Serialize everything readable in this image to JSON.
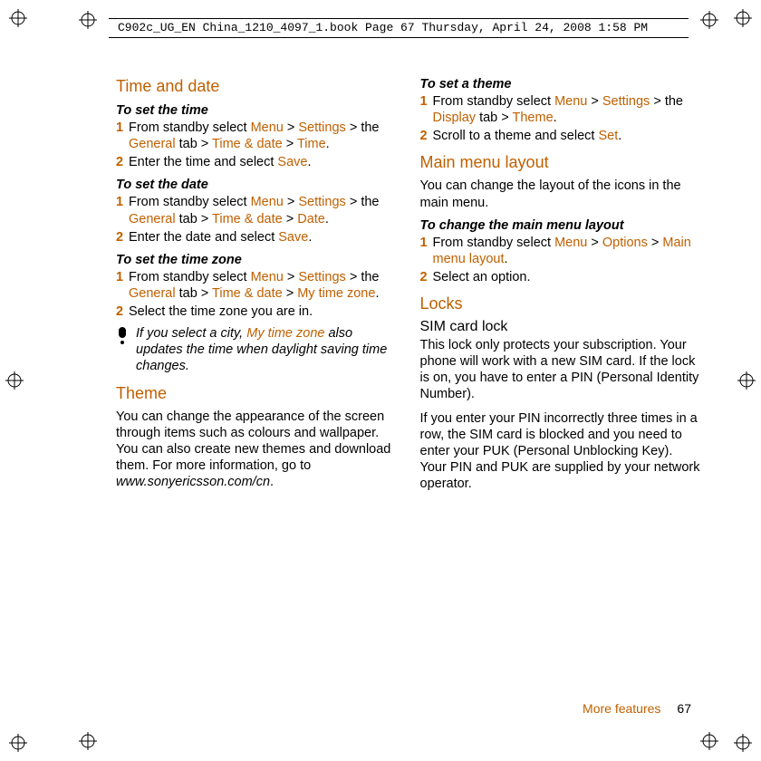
{
  "header_line": "C902c_UG_EN China_1210_4097_1.book  Page 67  Thursday, April 24, 2008  1:58 PM",
  "left": {
    "h_timeanddate": "Time and date",
    "sh_settime": "To set the time",
    "settime_1_a": "From standby select ",
    "settime_1_b": " > the ",
    "settime_1_c": " tab > ",
    "settime_1_d": " > ",
    "settime_1_e": ".",
    "m_menu": "Menu",
    "m_settings": "Settings",
    "m_general": "General",
    "m_timedate": "Time & date",
    "m_time": "Time",
    "settime_2_a": "Enter the time and select ",
    "m_save": "Save",
    "dot": ".",
    "sh_setdate": "To set the date",
    "setdate_1_a": "From standby select ",
    "setdate_1_b": " > the ",
    "setdate_1_c": " tab > ",
    "setdate_1_d": " > ",
    "m_date": "Date",
    "setdate_2_a": "Enter the date and select ",
    "sh_settz": "To set the time zone",
    "settz_1_a": "From standby select ",
    "settz_1_b": " > the ",
    "settz_1_c": " tab > ",
    "settz_1_d": " > ",
    "m_mytz": "My time zone",
    "settz_2": "Select the time zone you are in.",
    "note_a": "If you select a city, ",
    "note_b": " also updates the time when daylight saving time changes.",
    "h_theme": "Theme",
    "theme_body": "You can change the appearance of the screen through items such as colours and wallpaper. You can also create new themes and download them. For more information, go to ",
    "theme_url": "www.sonyericsson.com/cn",
    "theme_dot": "."
  },
  "right": {
    "sh_settheme": "To set a theme",
    "settheme_1_a": "From standby select ",
    "settheme_1_b": " > the ",
    "settheme_1_c": " tab > ",
    "m_display": "Display",
    "m_theme": "Theme",
    "settheme_2_a": "Scroll to a theme and select ",
    "m_set": "Set",
    "h_mainmenu": "Main menu layout",
    "mainmenu_body": "You can change the layout of the icons in the main menu.",
    "sh_changemain": "To change the main menu layout",
    "cm_1_a": "From standby select ",
    "cm_1_b": " > ",
    "m_options": "Options",
    "m_mainmenulayout": "Main menu layout",
    "cm_2": "Select an option.",
    "h_locks": "Locks",
    "sh_sim": "SIM card lock",
    "sim_body1": "This lock only protects your subscription. Your phone will work with a new SIM card. If the lock is on, you have to enter a PIN (Personal Identity Number).",
    "sim_body2": "If you enter your PIN incorrectly three times in a row, the SIM card is blocked and you need to enter your PUK (Personal Unblocking Key). Your PIN and PUK are supplied by your network operator."
  },
  "footer": {
    "label": "More features",
    "pagenum": "67"
  }
}
